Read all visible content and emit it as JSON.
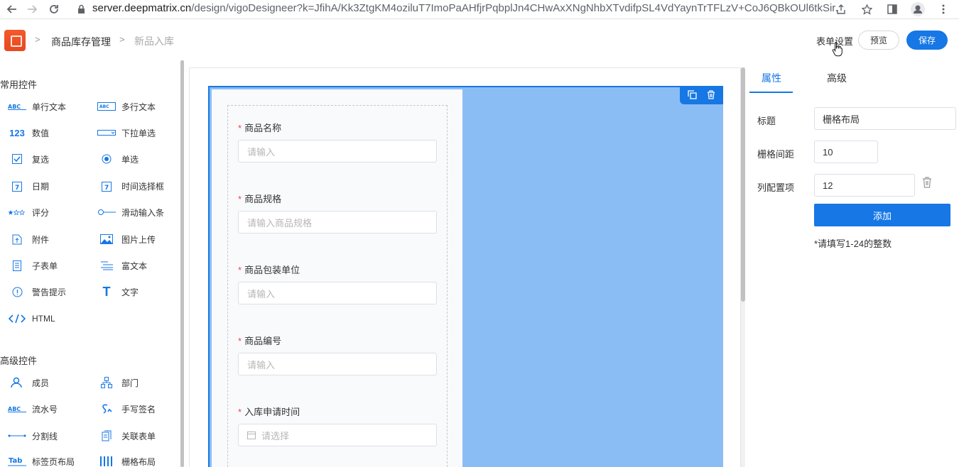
{
  "browser": {
    "url_host": "server.deepmatrix.cn",
    "url_path": "/design/vigoDesigneer?k=JfihA/Kk3ZtgKM4oziluT7ImoPaAHfjrPqbplJn4CHwAxXNgNhbXTvdifpSL4VdYaynTrTFLzV+CoJ6QBkOUl6tkSir..."
  },
  "header": {
    "breadcrumb_app": "商品库存管理",
    "breadcrumb_page": "新品入库",
    "form_settings": "表单设置",
    "preview": "预览",
    "save": "保存"
  },
  "left": {
    "common_title": "常用控件",
    "common": [
      {
        "label": "单行文本",
        "icon": "abc-icon"
      },
      {
        "label": "多行文本",
        "icon": "abc-multiline-icon"
      },
      {
        "label": "数值",
        "icon": "number-icon"
      },
      {
        "label": "下拉单选",
        "icon": "dropdown-icon"
      },
      {
        "label": "复选",
        "icon": "checkbox-icon"
      },
      {
        "label": "单选",
        "icon": "radio-icon"
      },
      {
        "label": "日期",
        "icon": "date-icon"
      },
      {
        "label": "时间选择框",
        "icon": "time-icon"
      },
      {
        "label": "评分",
        "icon": "star-icon"
      },
      {
        "label": "滑动输入条",
        "icon": "slider-icon"
      },
      {
        "label": "附件",
        "icon": "attachment-icon"
      },
      {
        "label": "图片上传",
        "icon": "image-icon"
      },
      {
        "label": "子表单",
        "icon": "subform-icon"
      },
      {
        "label": "富文本",
        "icon": "richtext-icon"
      },
      {
        "label": "警告提示",
        "icon": "alert-icon"
      },
      {
        "label": "文字",
        "icon": "text-icon"
      },
      {
        "label": "HTML",
        "icon": "html-icon"
      }
    ],
    "advanced_title": "高级控件",
    "advanced": [
      {
        "label": "成员",
        "icon": "member-icon"
      },
      {
        "label": "部门",
        "icon": "department-icon"
      },
      {
        "label": "流水号",
        "icon": "serial-icon"
      },
      {
        "label": "手写签名",
        "icon": "signature-icon"
      },
      {
        "label": "分割线",
        "icon": "divider-icon"
      },
      {
        "label": "关联表单",
        "icon": "linked-form-icon"
      },
      {
        "label": "标签页布局",
        "icon": "tab-layout-icon"
      },
      {
        "label": "栅格布局",
        "icon": "grid-layout-icon"
      }
    ]
  },
  "canvas": {
    "fields": [
      {
        "label": "商品名称",
        "placeholder": "请输入"
      },
      {
        "label": "商品规格",
        "placeholder": "请输入商品规格"
      },
      {
        "label": "商品包装单位",
        "placeholder": "请输入"
      },
      {
        "label": "商品编号",
        "placeholder": "请输入"
      },
      {
        "label": "入库申请时间",
        "placeholder": "请选择"
      }
    ]
  },
  "right": {
    "tab_props": "属性",
    "tab_advanced": "高级",
    "title_label": "标题",
    "title_value": "栅格布局",
    "gutter_label": "栅格间距",
    "gutter_value": "10",
    "cols_label": "列配置项",
    "cols_value": "12",
    "add": "添加",
    "hint": "*请填写1-24的整数"
  },
  "colors": {
    "accent": "#1677e5",
    "grid_fill": "#8bbdf5",
    "required": "#e34d4d"
  }
}
